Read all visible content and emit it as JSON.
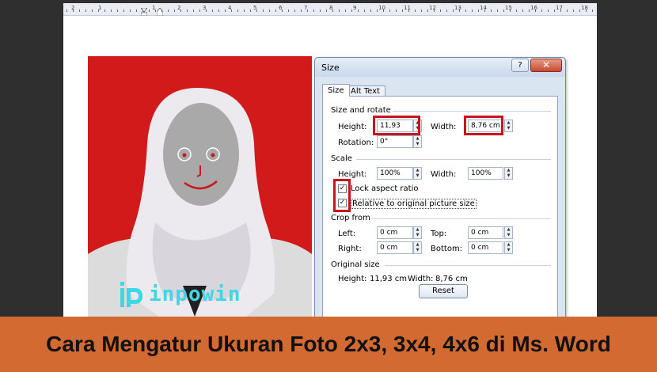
{
  "ruler": {
    "numbers": [
      "2",
      "1",
      "1",
      "2",
      "3",
      "4",
      "5",
      "6",
      "7",
      "8",
      "9",
      "10",
      "11",
      "12",
      "13",
      "14",
      "15",
      "16",
      "17",
      "18"
    ]
  },
  "dialog": {
    "title": "Size",
    "help_label": "?",
    "close_label": "✕",
    "tabs": [
      "Size",
      "Alt Text"
    ],
    "size_rotate": {
      "heading": "Size and rotate",
      "height_label": "Height:",
      "height_value": "11,93 cm",
      "width_label": "Width:",
      "width_value": "8,76 cm",
      "rotation_label": "Rotation:",
      "rotation_value": "0°"
    },
    "scale": {
      "heading": "Scale",
      "height_label": "Height:",
      "height_value": "100%",
      "width_label": "Width:",
      "width_value": "100%",
      "lock_aspect_label": "Lock aspect ratio",
      "lock_aspect_checked": true,
      "relative_label": "Relative to original picture size",
      "relative_checked": true
    },
    "crop": {
      "heading": "Crop from",
      "left_label": "Left:",
      "left_value": "0 cm",
      "top_label": "Top:",
      "top_value": "0 cm",
      "right_label": "Right:",
      "right_value": "0 cm",
      "bottom_label": "Bottom:",
      "bottom_value": "0 cm"
    },
    "original": {
      "heading": "Original size",
      "height_label": "Height:",
      "height_value": "11,93 cm",
      "width_label": "Width:",
      "width_value": "8,76 cm"
    },
    "reset_label": "Reset"
  },
  "watermark": {
    "text": "inpowin"
  },
  "banner": {
    "title": "Cara Mengatur Ukuran Foto 2x3, 3x4, 4x6 di Ms. Word"
  },
  "colors": {
    "photo_background": "#d21a1a",
    "highlight": "#c8141c",
    "banner": "#d26a32",
    "watermark": "#3fd7e6"
  }
}
